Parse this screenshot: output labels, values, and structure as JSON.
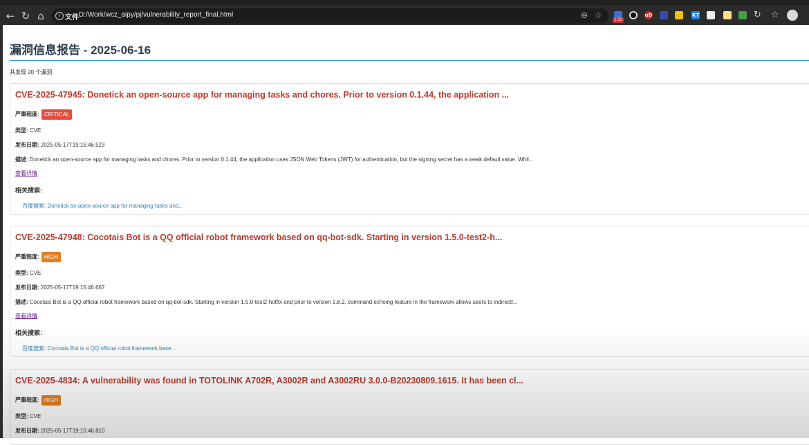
{
  "browser": {
    "scheme_label": "文件",
    "url": "D:/Work/wcz_aipy/pj/vulnerability_report_final.html",
    "ext_badge": "1.50",
    "ext_labels": [
      "uD",
      "KT"
    ]
  },
  "report": {
    "title": "漏洞信息报告 - 2025-06-16",
    "count_text": "共发现 20 个漏洞"
  },
  "labels": {
    "severity": "严重程度:",
    "type": "类型:",
    "date": "发布日期:",
    "desc": "描述:",
    "detail": "查看详情",
    "related": "相关搜索:"
  },
  "vulns": [
    {
      "title": "CVE-2025-47945: Donetick an open-source app for managing tasks and chores. Prior to version 0.1.44, the application ...",
      "severity": "CRITICAL",
      "type": "CVE",
      "date": "2025-05-17T19:15:46.523",
      "desc": "Donetick an open-source app for managing tasks and chores. Prior to version 0.1.44, the application uses JSON Web Tokens (JWT) for authentication, but the signing secret has a weak default value. Whil...",
      "search": "百度搜索: Donetick an open-source app for managing tasks and..."
    },
    {
      "title": "CVE-2025-47948: Cocotais Bot is a QQ official robot framework based on qq-bot-sdk. Starting in version 1.5.0-test2-h...",
      "severity": "HIGH",
      "type": "CVE",
      "date": "2025-05-17T19:15:46.667",
      "desc": "Cocotais Bot is a QQ official robot framework based on qq-bot-sdk. Starting in version 1.5.0-test2-hotfix and prior to version 1.6.2, command echoing feature in the framework allows users to indirectl...",
      "search": "百度搜索: Cocotais Bot is a QQ official robot framework base..."
    },
    {
      "title": "CVE-2025-4834: A vulnerability was found in TOTOLINK A702R, A3002R and A3002RU 3.0.0-B20230809.1615. It has been cl...",
      "severity": "HIGH",
      "type": "CVE",
      "date": "2025-05-17T19:15:46.810"
    }
  ]
}
